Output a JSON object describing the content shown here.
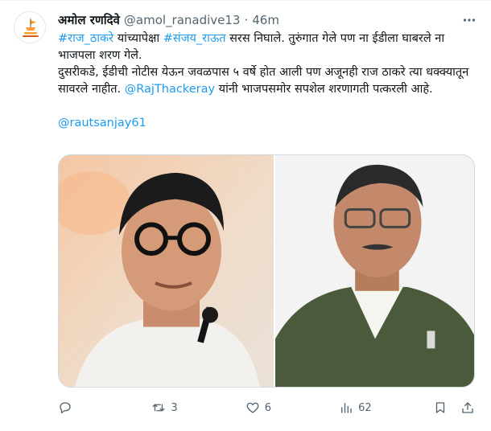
{
  "author": {
    "display_name": "अमोल रणदिवे",
    "handle": "@amol_ranadive13",
    "separator": "·",
    "time": "46m",
    "avatar_icon": "organization-logo-icon"
  },
  "tweet": {
    "hashtag_1": "#राज_ठाकरे",
    "text_1": " यांच्यापेक्षा ",
    "hashtag_2": "#संजय_राऊत",
    "text_2": " सरस निघाले. तुरुंगात गेले पण ना ईडीला घाबरले ना भाजपला शरण गेले.",
    "text_3": "दुसरीकडे, ईडीची नोटीस येऊन जवळपास ५ वर्षे होत आली पण अजूनही राज ठाकरे त्या धक्क्यातून सावरले नाहीत. ",
    "mention_1": "@RajThackeray",
    "text_4": " यांनी भाजपसमोर सपशेल शरणागती पत्करली आहे.",
    "mention_2": "@rautsanjay61"
  },
  "media": {
    "left_photo": "portrait-man-glasses",
    "right_photo": "portrait-man-spectacles-vest"
  },
  "actions": {
    "reply_count": "",
    "retweet_count": "3",
    "like_count": "6",
    "views_count": "62"
  },
  "colors": {
    "link": "#1d9bf0",
    "text": "#0f1419",
    "secondary": "#536471",
    "border": "#cfd9de"
  }
}
